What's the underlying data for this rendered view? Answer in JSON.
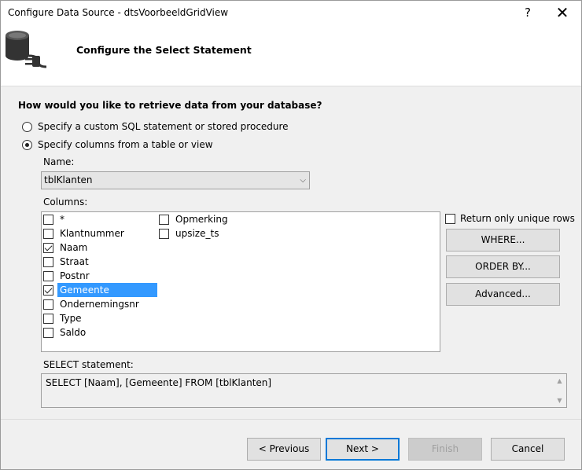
{
  "window": {
    "title": "Configure Data Source - dtsVoorbeeldGridView",
    "help_label": "?",
    "close_label": "✕"
  },
  "header": {
    "title": "Configure the Select Statement",
    "icon": "database-plug-icon"
  },
  "question": "How would you like to retrieve data from your database?",
  "options": {
    "custom_sql": {
      "label": "Specify a custom SQL statement or stored procedure",
      "checked": false
    },
    "columns_from_table": {
      "label": "Specify columns from a table or view",
      "checked": true
    }
  },
  "name": {
    "label": "Name:",
    "value": "tblKlanten",
    "dropdown_icon": "chevron-down-icon"
  },
  "columns": {
    "label": "Columns:",
    "items": [
      {
        "label": "*",
        "checked": false,
        "selected": false
      },
      {
        "label": "Klantnummer",
        "checked": false,
        "selected": false
      },
      {
        "label": "Naam",
        "checked": true,
        "selected": false
      },
      {
        "label": "Straat",
        "checked": false,
        "selected": false
      },
      {
        "label": "Postnr",
        "checked": false,
        "selected": false
      },
      {
        "label": "Gemeente",
        "checked": true,
        "selected": true
      },
      {
        "label": "Ondernemingsnr",
        "checked": false,
        "selected": false
      },
      {
        "label": "Type",
        "checked": false,
        "selected": false
      },
      {
        "label": "Saldo",
        "checked": false,
        "selected": false
      },
      {
        "label": "Opmerking",
        "checked": false,
        "selected": false
      },
      {
        "label": "upsize_ts",
        "checked": false,
        "selected": false
      }
    ]
  },
  "unique_rows": {
    "label": "Return only unique rows",
    "checked": false
  },
  "side_buttons": {
    "where": "WHERE...",
    "order_by": "ORDER BY...",
    "advanced": "Advanced..."
  },
  "sql": {
    "label": "SELECT statement:",
    "text": "SELECT [Naam], [Gemeente] FROM [tblKlanten]"
  },
  "footer": {
    "previous": "< Previous",
    "next": "Next >",
    "finish": "Finish",
    "cancel": "Cancel"
  },
  "colors": {
    "selection": "#3399ff",
    "default_button_border": "#0078d7",
    "dialog_background": "#f0f0f0"
  }
}
